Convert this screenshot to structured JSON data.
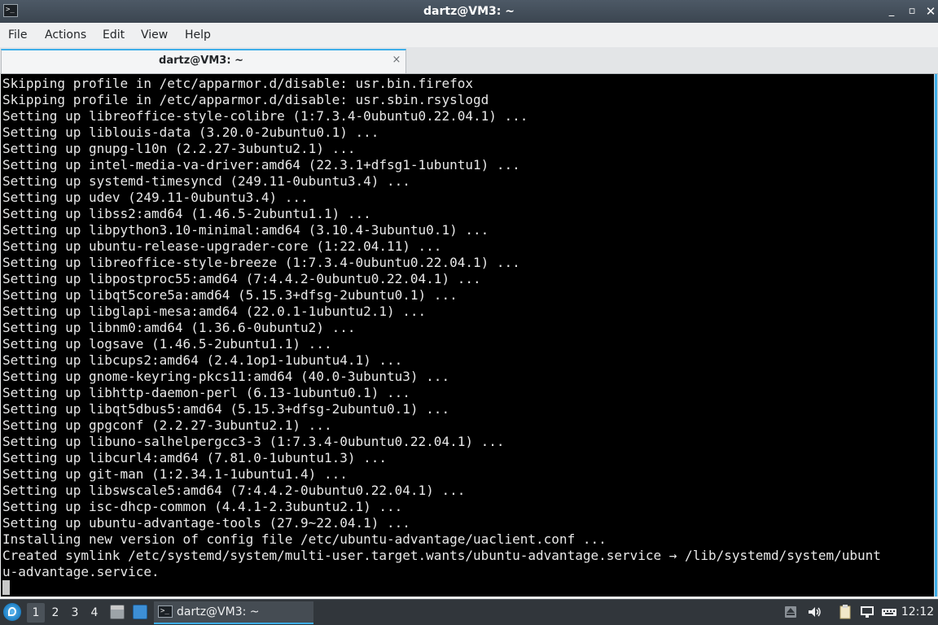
{
  "window": {
    "title": "dartz@VM3: ~",
    "app_icon": "terminal-icon",
    "controls": {
      "minimize": "_",
      "maximize": "▫",
      "close": "✕"
    }
  },
  "menu": {
    "items": [
      "File",
      "Actions",
      "Edit",
      "View",
      "Help"
    ]
  },
  "tabs": [
    {
      "label": "dartz@VM3: ~",
      "close": "×"
    }
  ],
  "terminal": {
    "lines": [
      "Skipping profile in /etc/apparmor.d/disable: usr.bin.firefox",
      "Skipping profile in /etc/apparmor.d/disable: usr.sbin.rsyslogd",
      "Setting up libreoffice-style-colibre (1:7.3.4-0ubuntu0.22.04.1) ...",
      "Setting up liblouis-data (3.20.0-2ubuntu0.1) ...",
      "Setting up gnupg-l10n (2.2.27-3ubuntu2.1) ...",
      "Setting up intel-media-va-driver:amd64 (22.3.1+dfsg1-1ubuntu1) ...",
      "Setting up systemd-timesyncd (249.11-0ubuntu3.4) ...",
      "Setting up udev (249.11-0ubuntu3.4) ...",
      "Setting up libss2:amd64 (1.46.5-2ubuntu1.1) ...",
      "Setting up libpython3.10-minimal:amd64 (3.10.4-3ubuntu0.1) ...",
      "Setting up ubuntu-release-upgrader-core (1:22.04.11) ...",
      "Setting up libreoffice-style-breeze (1:7.3.4-0ubuntu0.22.04.1) ...",
      "Setting up libpostproc55:amd64 (7:4.4.2-0ubuntu0.22.04.1) ...",
      "Setting up libqt5core5a:amd64 (5.15.3+dfsg-2ubuntu0.1) ...",
      "Setting up libglapi-mesa:amd64 (22.0.1-1ubuntu2.1) ...",
      "Setting up libnm0:amd64 (1.36.6-0ubuntu2) ...",
      "Setting up logsave (1.46.5-2ubuntu1.1) ...",
      "Setting up libcups2:amd64 (2.4.1op1-1ubuntu4.1) ...",
      "Setting up gnome-keyring-pkcs11:amd64 (40.0-3ubuntu3) ...",
      "Setting up libhttp-daemon-perl (6.13-1ubuntu0.1) ...",
      "Setting up libqt5dbus5:amd64 (5.15.3+dfsg-2ubuntu0.1) ...",
      "Setting up gpgconf (2.2.27-3ubuntu2.1) ...",
      "Setting up libuno-salhelpergcc3-3 (1:7.3.4-0ubuntu0.22.04.1) ...",
      "Setting up libcurl4:amd64 (7.81.0-1ubuntu1.3) ...",
      "Setting up git-man (1:2.34.1-1ubuntu1.4) ...",
      "Setting up libswscale5:amd64 (7:4.4.2-0ubuntu0.22.04.1) ...",
      "Setting up isc-dhcp-common (4.4.1-2.3ubuntu2.1) ...",
      "Setting up ubuntu-advantage-tools (27.9~22.04.1) ...",
      "Installing new version of config file /etc/ubuntu-advantage/uaclient.conf ...",
      "Created symlink /etc/systemd/system/multi-user.target.wants/ubuntu-advantage.service → /lib/systemd/system/ubunt",
      "u-advantage.service."
    ]
  },
  "taskbar": {
    "start_icon": "lubuntu-logo-icon",
    "desktops": [
      "1",
      "2",
      "3",
      "4"
    ],
    "active_desktop": "1",
    "quicklaunch": [
      "file-manager-icon",
      "show-desktop-icon"
    ],
    "task": {
      "label": "dartz@VM3: ~",
      "icon": "terminal-icon"
    },
    "tray": [
      "upload-arrow-icon",
      "volume-icon",
      "clipboard-icon",
      "network-icon",
      "keyboard-icon"
    ],
    "clock": "12:12"
  },
  "colors": {
    "accent": "#3daee9",
    "terminal_bg": "#000000",
    "terminal_fg": "#e8e8e8",
    "titlebar": "#3b4550",
    "taskbar": "#31363b"
  }
}
